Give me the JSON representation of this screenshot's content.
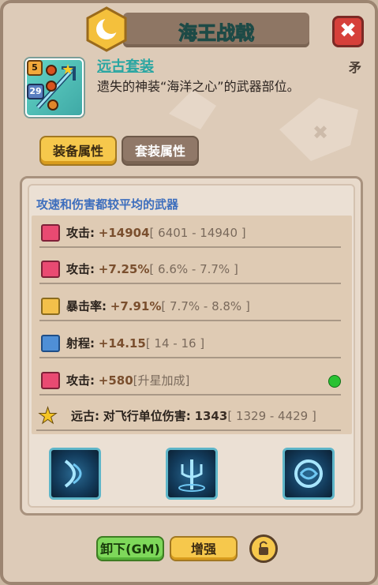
{
  "header": {
    "title": "海王战戟",
    "close_glyph": "✖"
  },
  "item": {
    "name": "远古套装",
    "description": "遗失的神装“海洋之心”的武器部位。",
    "type": "矛",
    "star_level": "5",
    "item_level": "29"
  },
  "tabs": [
    {
      "label": "装备属性",
      "active": true
    },
    {
      "label": "套装属性",
      "active": false
    }
  ],
  "panel": {
    "subtitle": "攻速和伤害都较平均的武器",
    "stats": [
      {
        "icon": "attack-icon",
        "label": "攻击:",
        "value": "+14904",
        "range": "[ 6401 - 14940 ]"
      },
      {
        "icon": "attack-icon",
        "label": "攻击:",
        "value": "+7.25%",
        "range": "[ 6.6% - 7.7% ]"
      },
      {
        "icon": "crit-icon",
        "label": "暴击率:",
        "value": "+7.91%",
        "range": "[ 7.7% - 8.8% ]"
      },
      {
        "icon": "range-icon",
        "label": "射程:",
        "value": "+14.15",
        "range": "[ 14 - 16 ]"
      },
      {
        "icon": "attack-icon",
        "label": "攻击:",
        "value": "+580",
        "range": "[升星加成]"
      }
    ],
    "set_bonus": {
      "icon": "star-icon",
      "prefix": "远古:",
      "label": "对飞行单位伤害:",
      "value": "1343",
      "range": "[ 1329 - 4429 ]"
    }
  },
  "skills": [
    {
      "icon": "wave-slash-icon"
    },
    {
      "icon": "trident-icon"
    },
    {
      "icon": "water-orb-icon"
    }
  ],
  "buttons": {
    "unequip": "卸下(GM)",
    "enhance": "增强",
    "lock_icon": "unlock-icon"
  },
  "colors": {
    "panel_bg": "#ddcbb8",
    "title_text": "#7fd3c7",
    "item_name": "#2aa6a2",
    "subtitle": "#3d6ebd",
    "tab_active": "#f6c84c",
    "button_green": "#7ed85a"
  }
}
